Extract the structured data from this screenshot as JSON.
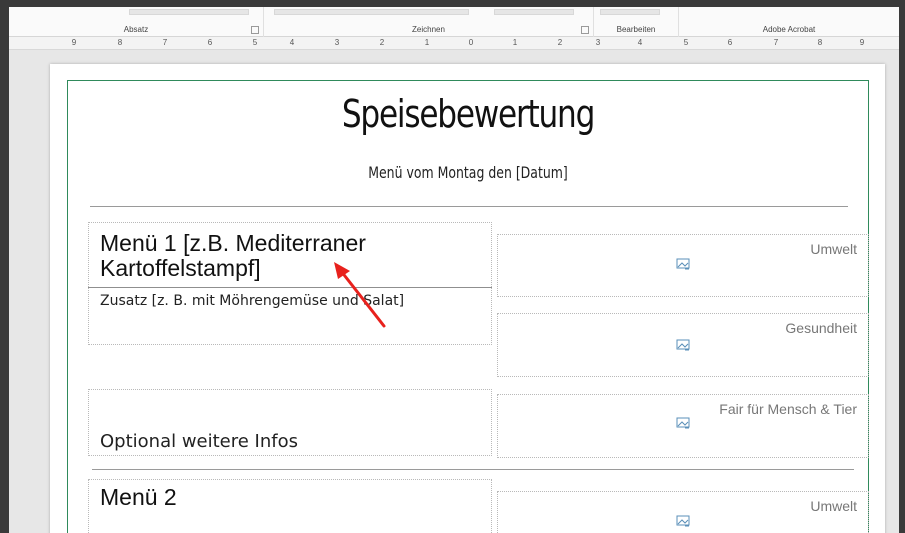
{
  "ribbon": {
    "groups": [
      {
        "label": "Absatz"
      },
      {
        "label": "Zeichnen"
      },
      {
        "label": "Bearbeiten"
      },
      {
        "label": "Adobe Acrobat"
      }
    ]
  },
  "ruler": {
    "labels": [
      "9",
      "8",
      "7",
      "6",
      "5",
      "4",
      "3",
      "2",
      "1",
      "0",
      "1",
      "2",
      "3",
      "4",
      "5",
      "6",
      "7",
      "8",
      "9"
    ]
  },
  "document": {
    "title": "Speisebewertung",
    "subtitle": "Menü vom Montag den [Datum]",
    "menu1": {
      "title_line1": "Menü 1 [z.B. Mediterraner",
      "title_line2": "Kartoffelstampf]",
      "addition": "Zusatz [z. B. mit Möhrengemüse und Salat]"
    },
    "optional_info": "Optional weitere Infos",
    "menu2": {
      "title": "Menü 2"
    },
    "ratings": [
      {
        "label": "Umwelt"
      },
      {
        "label": "Gesundheit"
      },
      {
        "label": "Fair für Mensch & Tier"
      },
      {
        "label": "Umwelt"
      }
    ]
  },
  "colors": {
    "frame_border": "#2f8a5b",
    "annotation_arrow": "#e8211d"
  },
  "icons": [
    "picture-placeholder-icon",
    "red-annotation-arrow"
  ]
}
